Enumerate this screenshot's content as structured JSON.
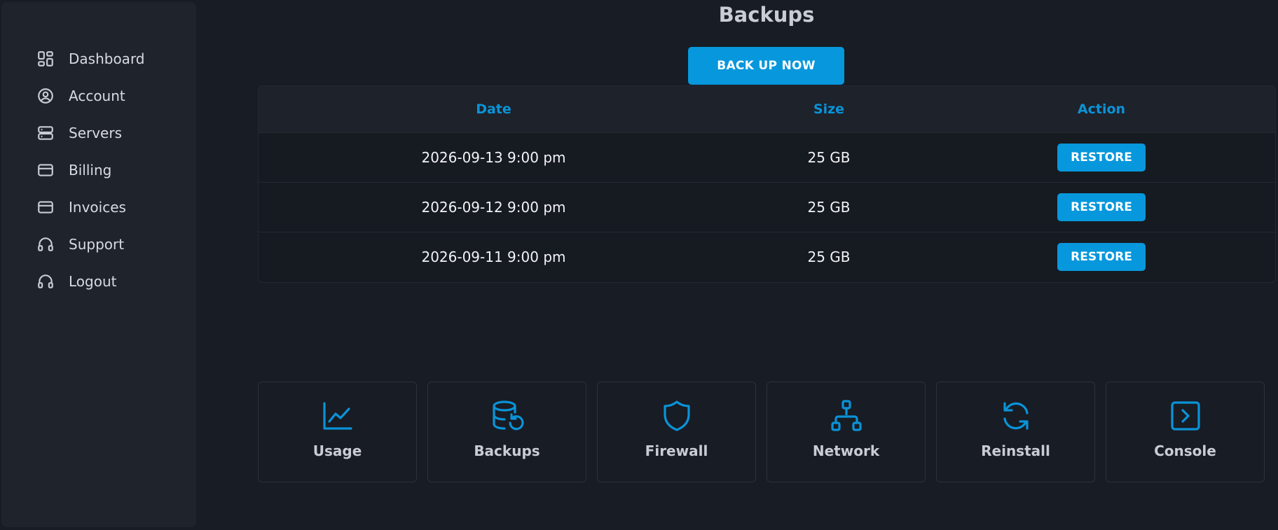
{
  "sidebar": {
    "items": [
      {
        "label": "Dashboard",
        "icon": "dashboard-icon"
      },
      {
        "label": "Account",
        "icon": "user-circle-icon"
      },
      {
        "label": "Servers",
        "icon": "server-icon"
      },
      {
        "label": "Billing",
        "icon": "credit-card-icon"
      },
      {
        "label": "Invoices",
        "icon": "credit-card-icon"
      },
      {
        "label": "Support",
        "icon": "headphones-icon"
      },
      {
        "label": "Logout",
        "icon": "headphones-icon"
      }
    ]
  },
  "main": {
    "title": "Backups",
    "backup_button": "BACK UP NOW",
    "table": {
      "headers": {
        "date": "Date",
        "size": "Size",
        "action": "Action"
      },
      "rows": [
        {
          "date": "2026-09-13 9:00 pm",
          "size": "25 GB",
          "action": "RESTORE"
        },
        {
          "date": "2026-09-12 9:00 pm",
          "size": "25 GB",
          "action": "RESTORE"
        },
        {
          "date": "2026-09-11 9:00 pm",
          "size": "25 GB",
          "action": "RESTORE"
        }
      ]
    },
    "tiles": [
      {
        "label": "Usage",
        "icon": "chart-line-icon"
      },
      {
        "label": "Backups",
        "icon": "database-restore-icon"
      },
      {
        "label": "Firewall",
        "icon": "shield-icon"
      },
      {
        "label": "Network",
        "icon": "network-icon"
      },
      {
        "label": "Reinstall",
        "icon": "refresh-icon"
      },
      {
        "label": "Console",
        "icon": "console-icon"
      }
    ]
  },
  "colors": {
    "background": "#181c24",
    "sidebar": "#1f232c",
    "accent": "#0797dc",
    "header_text": "#0a93d8"
  }
}
